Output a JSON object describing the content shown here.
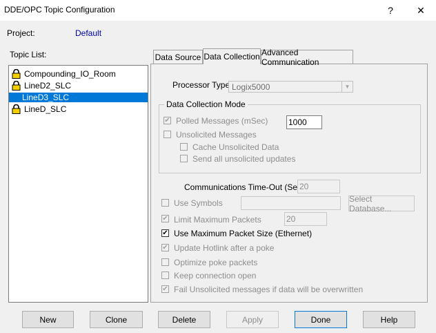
{
  "window": {
    "title": "DDE/OPC Topic Configuration",
    "help_label": "?",
    "close_label": "✕"
  },
  "project": {
    "label": "Project:",
    "value": "Default"
  },
  "topic_list": {
    "label": "Topic List:",
    "items": [
      {
        "label": "Compounding_IO_Room",
        "locked": true,
        "selected": false
      },
      {
        "label": "LineD2_SLC",
        "locked": true,
        "selected": false
      },
      {
        "label": "LineD3_SLC",
        "locked": false,
        "selected": true
      },
      {
        "label": "LineD_SLC",
        "locked": true,
        "selected": false
      }
    ]
  },
  "tabs": [
    {
      "label": "Data Source",
      "active": false
    },
    {
      "label": "Data Collection",
      "active": true
    },
    {
      "label": "Advanced Communication",
      "active": false
    }
  ],
  "processor": {
    "label": "Processor Type:",
    "value": "Logix5000"
  },
  "data_collection_mode": {
    "legend": "Data Collection Mode",
    "polled": {
      "label": "Polled Messages (mSec)",
      "checked": true,
      "value": "1000"
    },
    "unsolicited": {
      "label": "Unsolicited Messages",
      "checked": false
    },
    "cache": {
      "label": "Cache Unsolicited Data",
      "checked": false
    },
    "send_all": {
      "label": "Send all unsolicited updates",
      "checked": false
    }
  },
  "timeout": {
    "label": "Communications Time-Out (Secs):",
    "value": "20"
  },
  "use_symbols": {
    "label": "Use Symbols",
    "checked": false,
    "value": ""
  },
  "select_database_label": "Select Database...",
  "limit_packets": {
    "label": "Limit Maximum Packets",
    "checked": true,
    "value": "20"
  },
  "max_packet_size": {
    "label": "Use Maximum Packet Size (Ethernet)",
    "checked": true
  },
  "update_hotlink": {
    "label": "Update Hotlink after a poke",
    "checked": true
  },
  "optimize_poke": {
    "label": "Optimize poke packets",
    "checked": false
  },
  "keep_open": {
    "label": "Keep connection open",
    "checked": false
  },
  "fail_unsolicited": {
    "label": "Fail Unsolicited messages if data will be overwritten",
    "checked": true
  },
  "buttons": {
    "new": "New",
    "clone": "Clone",
    "delete": "Delete",
    "apply": "Apply",
    "done": "Done",
    "help": "Help"
  }
}
